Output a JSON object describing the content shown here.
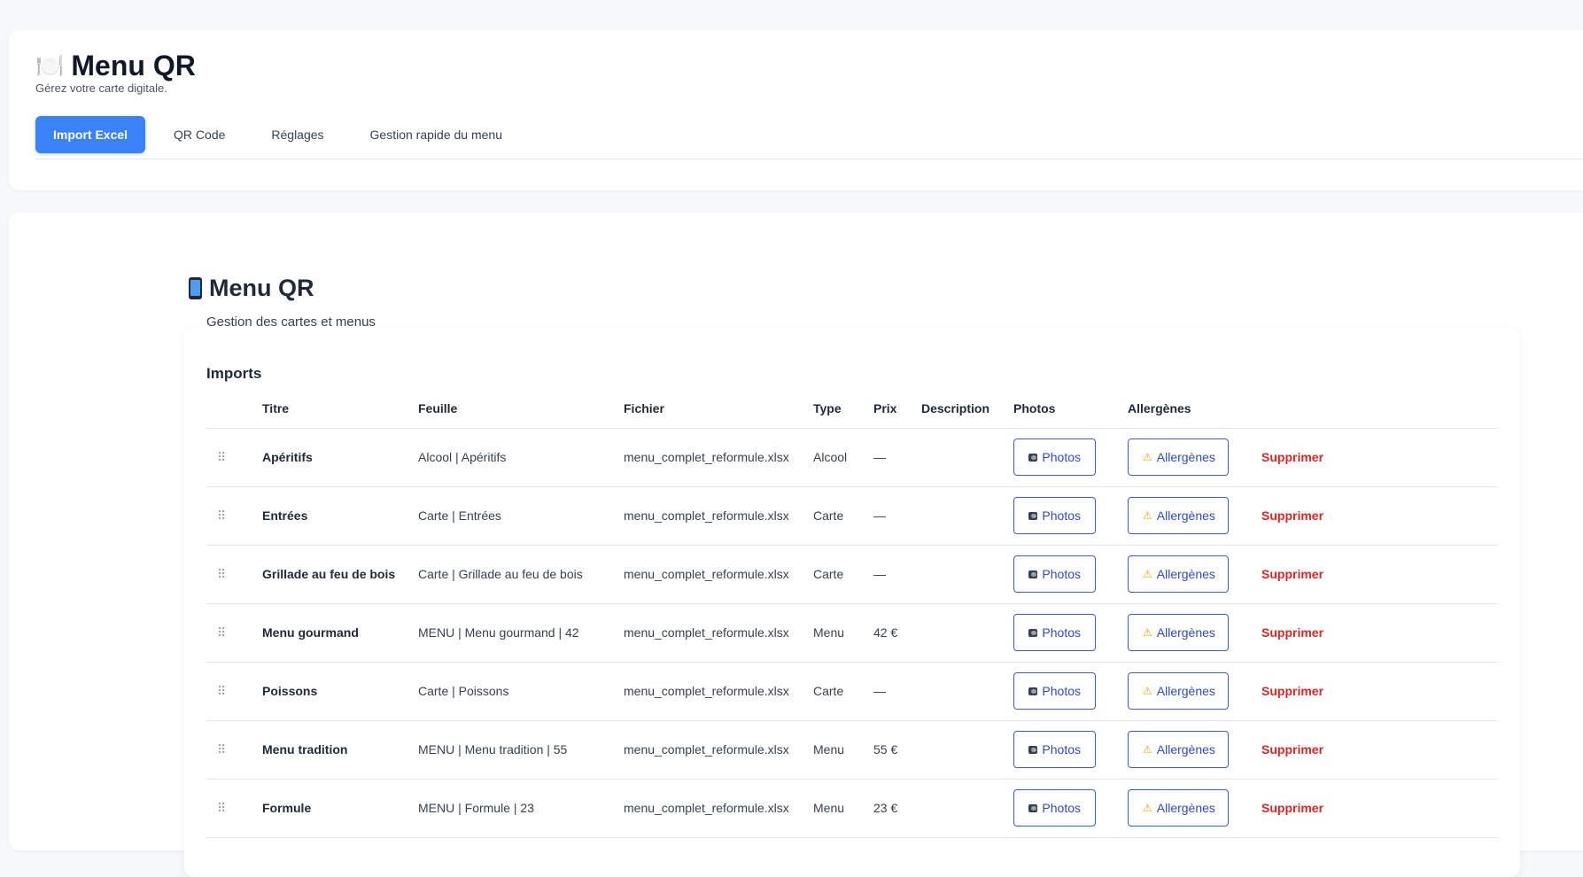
{
  "app": {
    "icon": "🍽️",
    "title": "Menu QR",
    "subtitle": "Gérez votre carte digitale."
  },
  "tabs": [
    {
      "label": "Import Excel",
      "active": true
    },
    {
      "label": "QR Code",
      "active": false
    },
    {
      "label": "Réglages",
      "active": false
    },
    {
      "label": "Gestion rapide du menu",
      "active": false
    }
  ],
  "page": {
    "icon": "phone-icon",
    "title": "Menu QR",
    "subtitle": "Gestion des cartes et menus"
  },
  "imports": {
    "heading": "Imports",
    "columns": [
      "Titre",
      "Feuille",
      "Fichier",
      "Type",
      "Prix",
      "Description",
      "Photos",
      "Allergènes"
    ],
    "photos_label": "Photos",
    "allergens_label": "Allergènes",
    "delete_label": "Supprimer",
    "drag_glyph": "⠿",
    "rows": [
      {
        "titre": "Apéritifs",
        "feuille": "Alcool | Apéritifs",
        "fichier": "menu_complet_reformule.xlsx",
        "type": "Alcool",
        "prix": "—",
        "description": ""
      },
      {
        "titre": "Entrées",
        "feuille": "Carte | Entrées",
        "fichier": "menu_complet_reformule.xlsx",
        "type": "Carte",
        "prix": "—",
        "description": ""
      },
      {
        "titre": "Grillade au feu de bois",
        "feuille": "Carte | Grillade au feu de bois",
        "fichier": "menu_complet_reformule.xlsx",
        "type": "Carte",
        "prix": "—",
        "description": ""
      },
      {
        "titre": "Menu gourmand",
        "feuille": "MENU | Menu gourmand | 42",
        "fichier": "menu_complet_reformule.xlsx",
        "type": "Menu",
        "prix": "42 €",
        "description": ""
      },
      {
        "titre": "Poissons",
        "feuille": "Carte | Poissons",
        "fichier": "menu_complet_reformule.xlsx",
        "type": "Carte",
        "prix": "—",
        "description": ""
      },
      {
        "titre": "Menu tradition",
        "feuille": "MENU | Menu tradition | 55",
        "fichier": "menu_complet_reformule.xlsx",
        "type": "Menu",
        "prix": "55 €",
        "description": ""
      },
      {
        "titre": "Formule",
        "feuille": "MENU | Formule | 23",
        "fichier": "menu_complet_reformule.xlsx",
        "type": "Menu",
        "prix": "23 €",
        "description": ""
      }
    ]
  },
  "colors": {
    "accent": "#3b82f6",
    "outline_button": "#3b5bdb",
    "delete": "#dc2626"
  }
}
